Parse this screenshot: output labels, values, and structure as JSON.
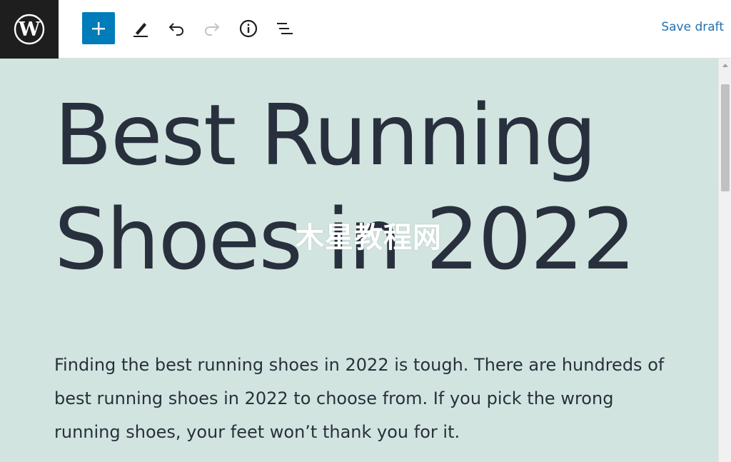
{
  "toolbar": {
    "logo_icon": "wordpress-logo-icon",
    "tools": [
      {
        "name": "add-block-button",
        "icon": "plus-icon"
      },
      {
        "name": "tools-button",
        "icon": "pencil-icon"
      },
      {
        "name": "undo-button",
        "icon": "undo-icon"
      },
      {
        "name": "redo-button",
        "icon": "redo-icon"
      },
      {
        "name": "details-button",
        "icon": "info-icon"
      },
      {
        "name": "list-view-button",
        "icon": "list-view-icon"
      }
    ],
    "save_draft_label": "Save draft"
  },
  "post": {
    "title": "Best Running Shoes in 2022",
    "paragraph": "Finding the best running shoes in 2022 is tough. There are hundreds of best running shoes in 2022 to choose from. If you pick the wrong running shoes, your feet won’t thank you for it."
  },
  "watermark": {
    "text": "木星教程网"
  },
  "colors": {
    "canvas_background": "#d2e4df",
    "text": "#28303d",
    "accent": "#007cba",
    "link": "#2271b1",
    "logo_background": "#1e1e1e"
  }
}
